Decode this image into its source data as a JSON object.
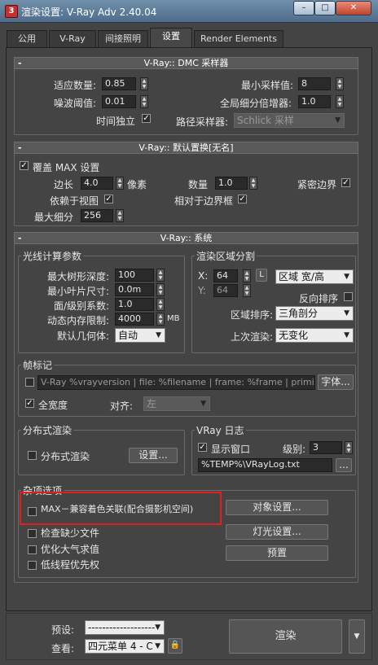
{
  "window": {
    "title": "渲染设置: V-Ray Adv 2.40.04",
    "app_icon": "3dsmax-icon"
  },
  "tabs": [
    "公用",
    "V-Ray",
    "间接照明",
    "设置",
    "Render Elements"
  ],
  "active_tab": "设置",
  "dmc": {
    "header": "V-Ray:: DMC 采样器",
    "adaptive_label": "适应数量:",
    "adaptive_value": "0.85",
    "min_samples_label": "最小采样值:",
    "min_samples_value": "8",
    "noise_label": "噪波阈值:",
    "noise_value": "0.01",
    "global_sub_label": "全局细分倍增器:",
    "global_sub_value": "1.0",
    "time_indep_label": "时间独立",
    "time_indep_checked": true,
    "path_sampler_label": "路径采样器:",
    "path_sampler_value": "Schlick 采样"
  },
  "displace": {
    "header": "V-Ray:: 默认置换[无名]",
    "override_label": "覆盖 MAX 设置",
    "override_checked": true,
    "edge_label": "边长",
    "edge_value": "4.0",
    "pixels_label": "像素",
    "amount_label": "数量",
    "amount_value": "1.0",
    "tight_label": "紧密边界",
    "tight_checked": true,
    "view_dep_label": "依赖于视图",
    "view_dep_checked": true,
    "relative_label": "相对于边界框",
    "relative_checked": true,
    "max_sub_label": "最大细分",
    "max_sub_value": "256"
  },
  "system": {
    "header": "V-Ray:: 系统",
    "raycast": {
      "title": "光线计算参数",
      "max_tree_label": "最大树形深度:",
      "max_tree_value": "100",
      "min_leaf_label": "最小叶片尺寸:",
      "min_leaf_value": "0.0m",
      "face_label": "面/级别系数:",
      "face_value": "1.0",
      "mem_label": "动态内存限制:",
      "mem_value": "4000",
      "mem_unit": "MB",
      "geom_label": "默认几何体:",
      "geom_value": "自动"
    },
    "region": {
      "title": "渲染区域分割",
      "x_label": "X:",
      "x_value": "64",
      "l_label": "L",
      "y_label": "Y:",
      "y_value": "64",
      "mode_value": "区域 宽/高",
      "reverse_label": "反向排序",
      "reverse_checked": false,
      "order_label": "区域排序:",
      "order_value": "三角剖分",
      "prev_label": "上次渲染:",
      "prev_value": "无变化"
    },
    "stamp": {
      "title": "帧标记",
      "enabled": false,
      "text": "V-Ray %vrayversion | file: %filename | frame: %frame | primitives: %",
      "font_button": "字体...",
      "full_width_label": "全宽度",
      "full_width_checked": true,
      "align_label": "对齐:",
      "align_value": "左"
    },
    "dist": {
      "title": "分布式渲染",
      "dr_label": "分布式渲染",
      "dr_checked": false,
      "settings_button": "设置..."
    },
    "log": {
      "title": "VRay 日志",
      "show_label": "显示窗口",
      "show_checked": true,
      "level_label": "级别:",
      "level_value": "3",
      "path_value": "%TEMP%\\VRayLog.txt",
      "browse_button": "..."
    },
    "misc": {
      "title": "杂项选项",
      "max_compat_label": "MAX－兼容着色关联(配合摄影机空间)",
      "max_compat_checked": false,
      "check_missing_label": "检查缺少文件",
      "check_missing_checked": false,
      "opt_atmo_label": "优化大气求值",
      "opt_atmo_checked": false,
      "low_thread_label": "低线程优先权",
      "low_thread_checked": false,
      "object_button": "对象设置...",
      "light_button": "灯光设置...",
      "presets_button": "预置"
    }
  },
  "bottom": {
    "preset_label": "预设:",
    "preset_value": "-------------------",
    "view_label": "查看:",
    "view_value": "四元菜单 4 - C",
    "lock_icon": "lock-icon",
    "render_button": "渲染"
  },
  "colors": {
    "highlight": "#e02020",
    "title_bar": "#5a7a99"
  }
}
